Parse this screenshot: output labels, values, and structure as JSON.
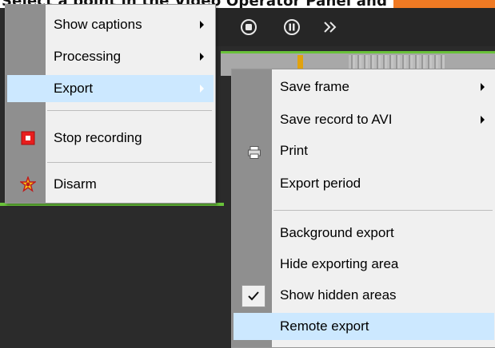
{
  "top_strip": {
    "text": "Select a point in the Video Operator Panel and the Video Se",
    "accent_color": "#f07a23"
  },
  "toolbar": {
    "icons": [
      "stop-icon",
      "pause-icon",
      "fast-forward-icon"
    ]
  },
  "main_menu": {
    "items": [
      {
        "label": "Show captions",
        "has_submenu": true
      },
      {
        "label": "Processing",
        "has_submenu": true
      },
      {
        "label": "Export",
        "has_submenu": true,
        "highlighted": true
      },
      {
        "label": "Stop recording",
        "icon": "stop-recording-icon"
      },
      {
        "label": "Disarm",
        "icon": "disarm-icon"
      }
    ]
  },
  "export_submenu": {
    "items": [
      {
        "label": "Save frame",
        "has_submenu": true
      },
      {
        "label": "Save record to AVI",
        "has_submenu": true
      },
      {
        "label": "Print",
        "icon": "printer-icon"
      },
      {
        "label": "Export period"
      },
      {
        "label": "Background export"
      },
      {
        "label": "Hide exporting area"
      },
      {
        "label": "Show hidden areas",
        "checked": true
      },
      {
        "label": "Remote export",
        "highlighted": true
      }
    ]
  },
  "colors": {
    "highlight": "#cce8ff",
    "menu_bg": "#f0f0f0",
    "video_bg": "#2b2b2b",
    "green_border": "#69c23a",
    "stop_red": "#e81e1e",
    "disarm_yellow": "#f5c518"
  }
}
